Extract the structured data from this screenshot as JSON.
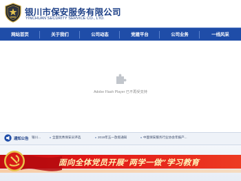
{
  "header": {
    "title_cn": "银川市保安服务有限公司",
    "title_en": "YINCHUAN SECURITY SERVICE CO., LTD."
  },
  "nav": {
    "items": [
      {
        "label": "网站首页"
      },
      {
        "label": "关于我们"
      },
      {
        "label": "公司动态"
      },
      {
        "label": "党建平台"
      },
      {
        "label": "公司业务"
      },
      {
        "label": "一线风采"
      }
    ]
  },
  "flash": {
    "message": "Adobe Flash Player 已不再受支持"
  },
  "notice": {
    "label": "通知公告",
    "items": [
      "银川...",
      "全国优秀保安员评选",
      "2019年五一放假通知",
      "中国保安服务行业协会年报产..."
    ]
  },
  "banner": {
    "slogan": "面向全体党员开展“两学一做”学习教育"
  },
  "colors": {
    "brand_blue": "#1f4da8",
    "title_blue": "#1b3e86",
    "banner_red": "#d81e18"
  },
  "icons": {
    "logo": "security-shield-logo",
    "flash": "puzzle-piece-icon",
    "notice": "megaphone-icon",
    "emblem": "party-emblem-icon"
  }
}
